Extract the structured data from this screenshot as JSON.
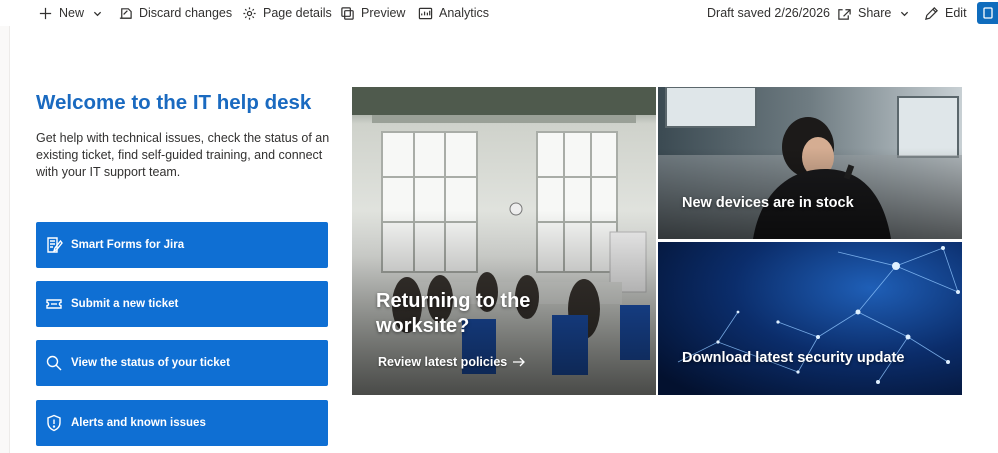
{
  "command_bar": {
    "new_label": "New",
    "discard_label": "Discard changes",
    "page_details_label": "Page details",
    "preview_label": "Preview",
    "analytics_label": "Analytics",
    "draft_status": "Draft saved 2/26/2026",
    "share_label": "Share",
    "edit_label": "Edit",
    "icons": [
      "plus-icon",
      "discard-icon",
      "gear-icon",
      "preview-icon",
      "analytics-icon",
      "share-icon",
      "pencil-icon",
      "publish-icon"
    ],
    "accent_color": "#0f6cbd"
  },
  "welcome": {
    "title": "Welcome to the IT help desk",
    "intro": "Get help with technical issues, check the status of an existing ticket, find self-guided training, and connect with your IT support team.",
    "title_color": "#1a6ac0"
  },
  "quick_links": {
    "button_color": "#0f6fd3",
    "items": [
      {
        "label": "Smart Forms for Jira",
        "icon": "form-icon"
      },
      {
        "label": "Submit a new ticket",
        "icon": "ticket-icon"
      },
      {
        "label": "View the status of your ticket",
        "icon": "search-icon"
      },
      {
        "label": "Alerts and known issues",
        "icon": "shield-icon"
      }
    ]
  },
  "hero": {
    "main": {
      "heading": "Returning to the worksite?",
      "link_label": "Review latest policies",
      "icon": "arrow-right-icon"
    },
    "top_right": {
      "caption": "New devices are in stock"
    },
    "bottom_right": {
      "caption": "Download latest security update"
    }
  }
}
